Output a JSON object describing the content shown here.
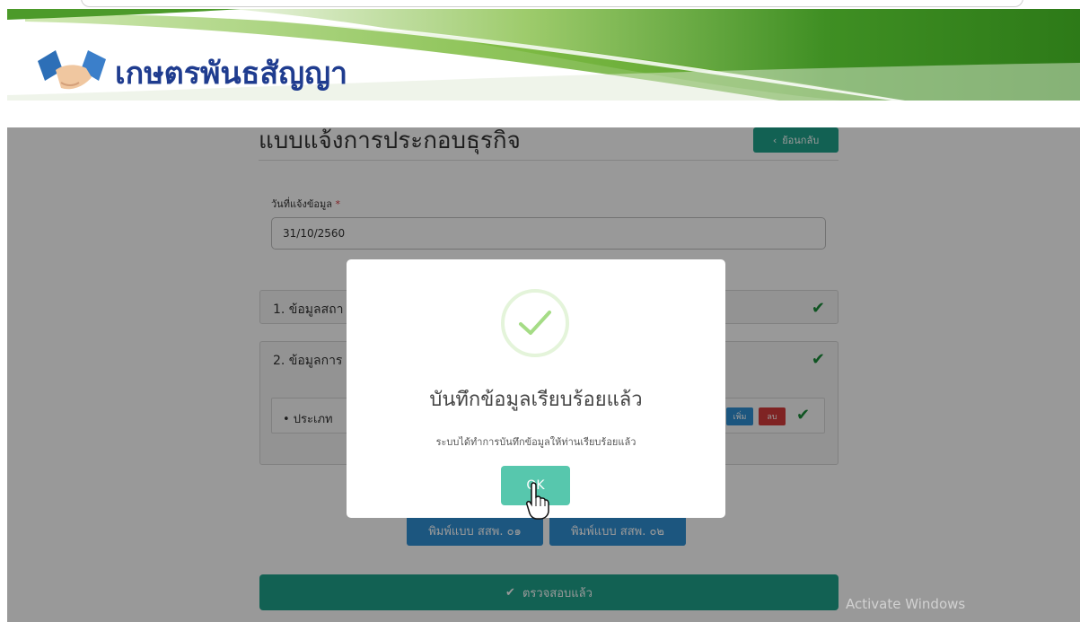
{
  "header": {
    "brand_name": "เกษตรพันธสัญญา",
    "logo_icon": "handshake-icon"
  },
  "page": {
    "title": "แบบแจ้งการประกอบธุรกิจ",
    "back_button": "ย้อนกลับ",
    "date_label": "วันที่แจ้งข้อมูล",
    "required_mark": "*",
    "date_value": "31/10/2560"
  },
  "sections": [
    {
      "title": "1. ข้อมูลสถา",
      "status_icon": "check-icon"
    },
    {
      "title": "2. ข้อมูลการ",
      "status_icon": "check-icon"
    }
  ],
  "subitem": {
    "label": "• ประเภท",
    "add_label": "เพิ่ม",
    "delete_label": "ลบ"
  },
  "actions": {
    "print_form_1": "พิมพ์แบบ สสพ. ๐๑",
    "print_form_2": "พิมพ์แบบ สสพ. ๐๒",
    "verified_label": "ตรวจสอบแล้ว"
  },
  "modal": {
    "title": "บันทึกข้อมูลเรียบร้อยแล้ว",
    "message": "ระบบได้ทำการบันทึกข้อมูลให้ท่านเรียบร้อยแล้ว",
    "ok_label": "OK",
    "success_color": "#a5dc86"
  },
  "watermark": "Activate Windows",
  "colors": {
    "brand_blue": "#1f3c8f",
    "teal": "#1fa28b",
    "blue_button": "#2f8fd4",
    "danger": "#d43b3b",
    "banner_green": "#5aa42e"
  }
}
